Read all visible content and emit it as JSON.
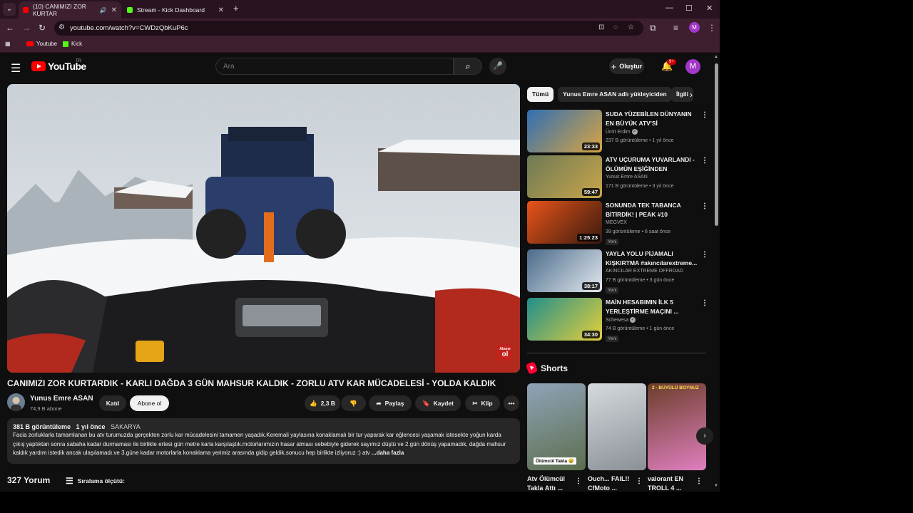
{
  "browser": {
    "tabs": [
      {
        "title": "(10) CANIMIZI ZOR KURTAR",
        "favicon_color": "#ff0000",
        "active": true
      },
      {
        "title": "Stream - Kick Dashboard",
        "favicon_color": "#53fc18",
        "active": false
      }
    ],
    "new_tab": "+",
    "url": "youtube.com/watch?v=CWDzQbKuP6c",
    "profile_initial": "M",
    "bookmarks": [
      {
        "label": "Youtube",
        "icon": "youtube-icon",
        "color": "#ff0000"
      },
      {
        "label": "Kick",
        "icon": "kick-icon",
        "color": "#53fc18"
      }
    ]
  },
  "youtube": {
    "logo_text": "YouTube",
    "region": "TR",
    "search_placeholder": "Ara",
    "create_label": "Oluştur",
    "notification_badge": "9+",
    "avatar_initial": "M"
  },
  "video": {
    "title": "CANIMIZI ZOR KURTARDIK - KARLI DAĞDA 3 GÜN MAHSUR KALDIK - ZORLU ATV KAR MÜCADELESİ - YOLDA KALDIK",
    "watermark_top": "Abone",
    "watermark_bottom": "ol",
    "channel": "Yunus Emre ASAN",
    "subscribers": "74,9 B abone",
    "join_label": "Katıl",
    "subscribe_label": "Abone ol",
    "likes": "2,3 B",
    "share_label": "Paylaş",
    "save_label": "Kaydet",
    "clip_label": "Klip",
    "description": {
      "views": "381 B görüntüleme",
      "age": "1 yıl önce",
      "location": "SAKARYA",
      "text": "Facia zorluklarla tamamlanan bu atv turumuzda gerçekten zorlu kar mücadelesini tamamen yaşadık.Keremali yaylasına konaklamalı bir tur yaparak kar eğlencesi yaşamak istesekte yoğun karda çıkış yaptıktan sonra sabaha kadar durmaması ile birlikte ertesi gün metre karla karşılaştık.motorlarımızın hasar alması sebebiyle giderek sayımız düştü ve 2.gün dönüş yapamadık, dağda mahsur kaldık yardım istedik ancak ulaşılamadı.ve 3.güne kadar motorlarla konaklama yerimiz arasında gidip geldik.sonucu hep birlikte izliyoruz :) atv",
      "more": "...daha fazla"
    },
    "comments_count": "327 Yorum",
    "sort_label": "Sıralama ölçütü:"
  },
  "sidebar": {
    "chips": [
      "Tümü",
      "Yunus Emre ASAN adlı yükleyiciden",
      "İlgili"
    ],
    "recommendations": [
      {
        "title": "SUDA YÜZEBİLEN DÜNYANIN EN BÜYÜK ATV'Sİ",
        "channel": "Ümit Erdim",
        "verified": true,
        "views": "237 B görüntüleme",
        "age": "1 yıl önce",
        "duration": "23:33",
        "new": "",
        "colors": [
          "#2f6fb3",
          "#d9a441"
        ]
      },
      {
        "title": "ATV UÇURUMA YUVARLANDI - ÖLÜMÜN EŞİĞİNDEN DÖNDÜK...",
        "channel": "Yunus Emre ASAN",
        "verified": false,
        "views": "171 B görüntüleme",
        "age": "3 yıl önce",
        "duration": "59:47",
        "new": "",
        "colors": [
          "#6d7a55",
          "#c9a54a"
        ]
      },
      {
        "title": "SONUNDA TEK TABANCA BİTİRDİK! | PEAK #10",
        "channel": "MEGVEX",
        "verified": false,
        "views": "39 görüntüleme",
        "age": "6 saat önce",
        "duration": "1:25:23",
        "new": "Yeni",
        "colors": [
          "#e8541a",
          "#3a1a0e"
        ]
      },
      {
        "title": "YAYLA YOLU PİJAMALI KIŞKIRTMA #akıncılarextreme...",
        "channel": "AKINCILAR EXTREME OFFROAD",
        "verified": false,
        "views": "77 B görüntüleme",
        "age": "3 gün önce",
        "duration": "38:17",
        "new": "Yeni",
        "colors": [
          "#4a6b8a",
          "#e3e8ee"
        ]
      },
      {
        "title": "MAİN HESABIMIN İLK 5 YERLEŞTİRME MAÇINI ...",
        "channel": "Schewesa",
        "verified": true,
        "views": "74 B görüntüleme",
        "age": "1 gün önce",
        "duration": "34:30",
        "new": "Yeni",
        "colors": [
          "#1f8f8c",
          "#e6cf3a"
        ]
      }
    ],
    "shorts_title": "Shorts",
    "shorts": [
      {
        "caption": "Atv Ölümcül Taklа Attı ...",
        "label": "Ölümcül Takla 😅",
        "toplabel": "",
        "colors": [
          "#8fa3b8",
          "#5c6e4d"
        ]
      },
      {
        "caption": "Ouch... FAIL!! CfMoto ...",
        "label": "",
        "toplabel": "",
        "colors": [
          "#d5dade",
          "#8b9097"
        ]
      },
      {
        "caption": "valorant EN TROLL 4 ...",
        "label": "",
        "toplabel": "2 - BÜYÜLÜ BOYNUZ",
        "colors": [
          "#6c3e2a",
          "#e07fbf"
        ]
      }
    ]
  }
}
